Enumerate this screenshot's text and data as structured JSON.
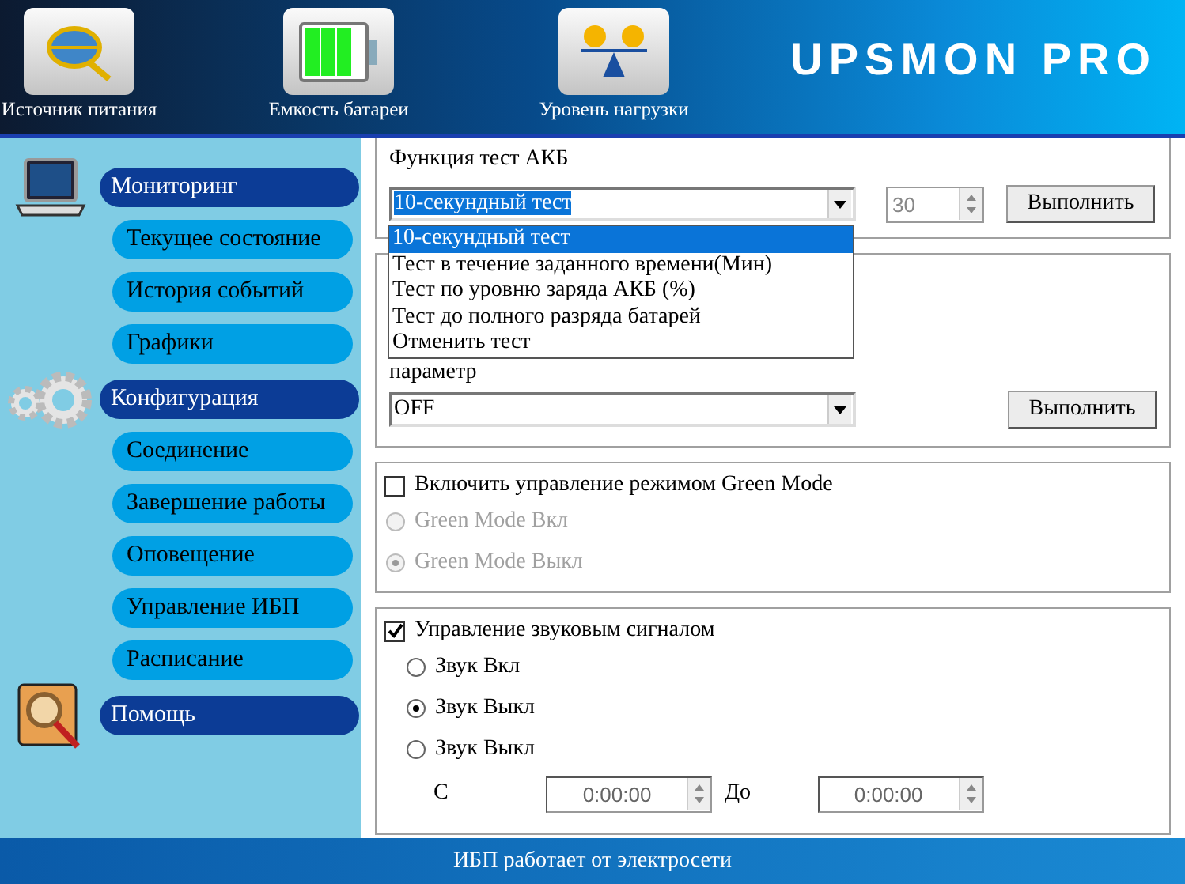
{
  "header": {
    "tiles": [
      {
        "kind": "power",
        "label": "Источник питания"
      },
      {
        "kind": "battery",
        "label": "Емкость батареи"
      },
      {
        "kind": "load",
        "label": "Уровень нагрузки"
      }
    ],
    "logo": "UPSMON PRO"
  },
  "sidebar": {
    "groups": [
      {
        "kind": "monitor",
        "label": "Мониторинг",
        "items": [
          "Текущее состояние",
          "История событий",
          "Графики"
        ]
      },
      {
        "kind": "config",
        "label": "Конфигурация",
        "items": [
          "Соединение",
          "Завершение работы",
          "Оповещение",
          "Управление ИБП",
          "Расписание"
        ]
      },
      {
        "kind": "help",
        "label": "Помощь"
      }
    ]
  },
  "battery_test": {
    "title": "Функция тест АКБ",
    "select": {
      "value": "10-секундный тест",
      "expanded": true,
      "options": [
        {
          "label": "10-секундный тест",
          "selected": true
        },
        {
          "label": "Тест в течение заданного времени(Мин)",
          "selected": false
        },
        {
          "label": "Тест по уровню заряда АКБ (%)",
          "selected": false
        },
        {
          "label": "Тест до полного разряда батарей",
          "selected": false
        },
        {
          "label": "Отменить тест",
          "selected": false
        }
      ]
    },
    "spinner": {
      "value": "30",
      "disabled": true
    },
    "button": "Выполнить"
  },
  "parameter": {
    "label": "параметр",
    "select": {
      "value": "OFF"
    },
    "button": "Выполнить"
  },
  "green_mode": {
    "label": "Включить управление режимом Green Mode",
    "checked": false,
    "options": [
      {
        "label": "Green Mode Вкл",
        "selected": false,
        "disabled": true
      },
      {
        "label": "Green Mode Выкл",
        "selected": true,
        "disabled": true
      }
    ]
  },
  "sound": {
    "label": "Управление звуковым сигналом",
    "checked": true,
    "options": [
      {
        "label": "Звук Вкл",
        "selected": false,
        "disabled": false
      },
      {
        "label": "Звук Выкл",
        "selected": true,
        "disabled": false
      },
      {
        "label": "Звук Выкл",
        "selected": false,
        "disabled": false
      }
    ],
    "from_label": "С",
    "from_value": "0:00:00",
    "to_label": "До",
    "to_value": "0:00:00"
  },
  "status_bar": "ИБП работает от электросети"
}
